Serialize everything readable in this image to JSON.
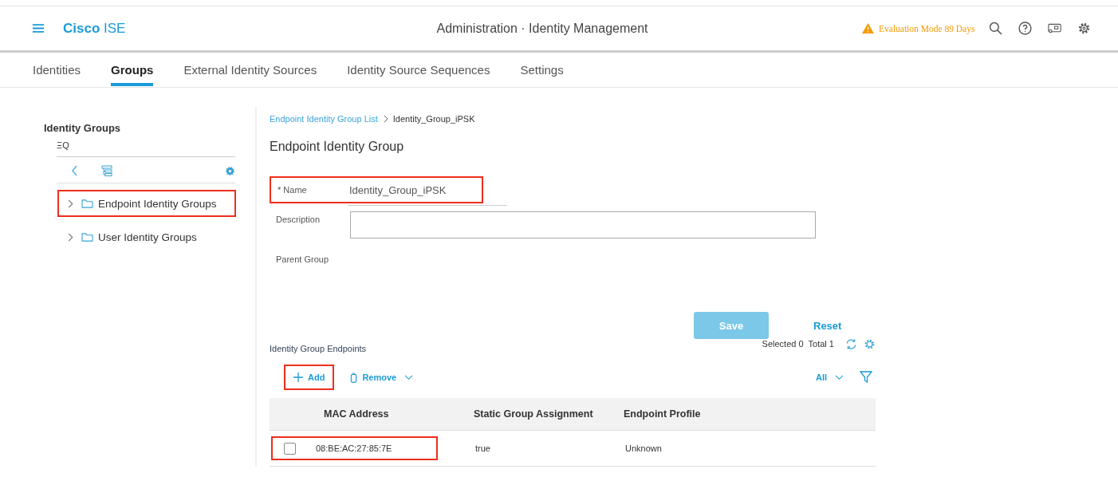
{
  "header": {
    "brand": "Cisco",
    "product": "ISE",
    "title": "Administration · Identity Management",
    "warning": "Evaluation Mode 89 Days"
  },
  "tabs": [
    {
      "label": "Identities",
      "selected": false
    },
    {
      "label": "Groups",
      "selected": true
    },
    {
      "label": "External Identity Sources",
      "selected": false
    },
    {
      "label": "Identity Source Sequences",
      "selected": false
    },
    {
      "label": "Settings",
      "selected": false
    }
  ],
  "sidebar": {
    "title": "Identity Groups",
    "search_icon_text": "ΞQ",
    "items": [
      {
        "label": "Endpoint Identity Groups",
        "highlighted": true
      },
      {
        "label": "User Identity Groups",
        "highlighted": false
      }
    ]
  },
  "breadcrumb": {
    "link": "Endpoint Identity Group List",
    "current": "Identity_Group_iPSK"
  },
  "form": {
    "title": "Endpoint Identity Group",
    "name_label": "* Name",
    "name_value": "Identity_Group_iPSK",
    "name_highlighted": true,
    "description_label": "Description",
    "parent_label": "Parent Group",
    "save": "Save",
    "reset": "Reset"
  },
  "endpoints": {
    "title": "Identity Group Endpoints",
    "selected": "Selected 0",
    "total": "Total 1",
    "add": "Add",
    "add_highlighted": true,
    "remove": "Remove",
    "filter": "All",
    "columns": [
      "MAC Address",
      "Static Group Assignment",
      "Endpoint Profile"
    ],
    "rows": [
      {
        "checked": false,
        "highlighted": true,
        "cells": [
          "08:BE:AC:27:85:7E",
          "true",
          "Unknown"
        ]
      }
    ]
  }
}
